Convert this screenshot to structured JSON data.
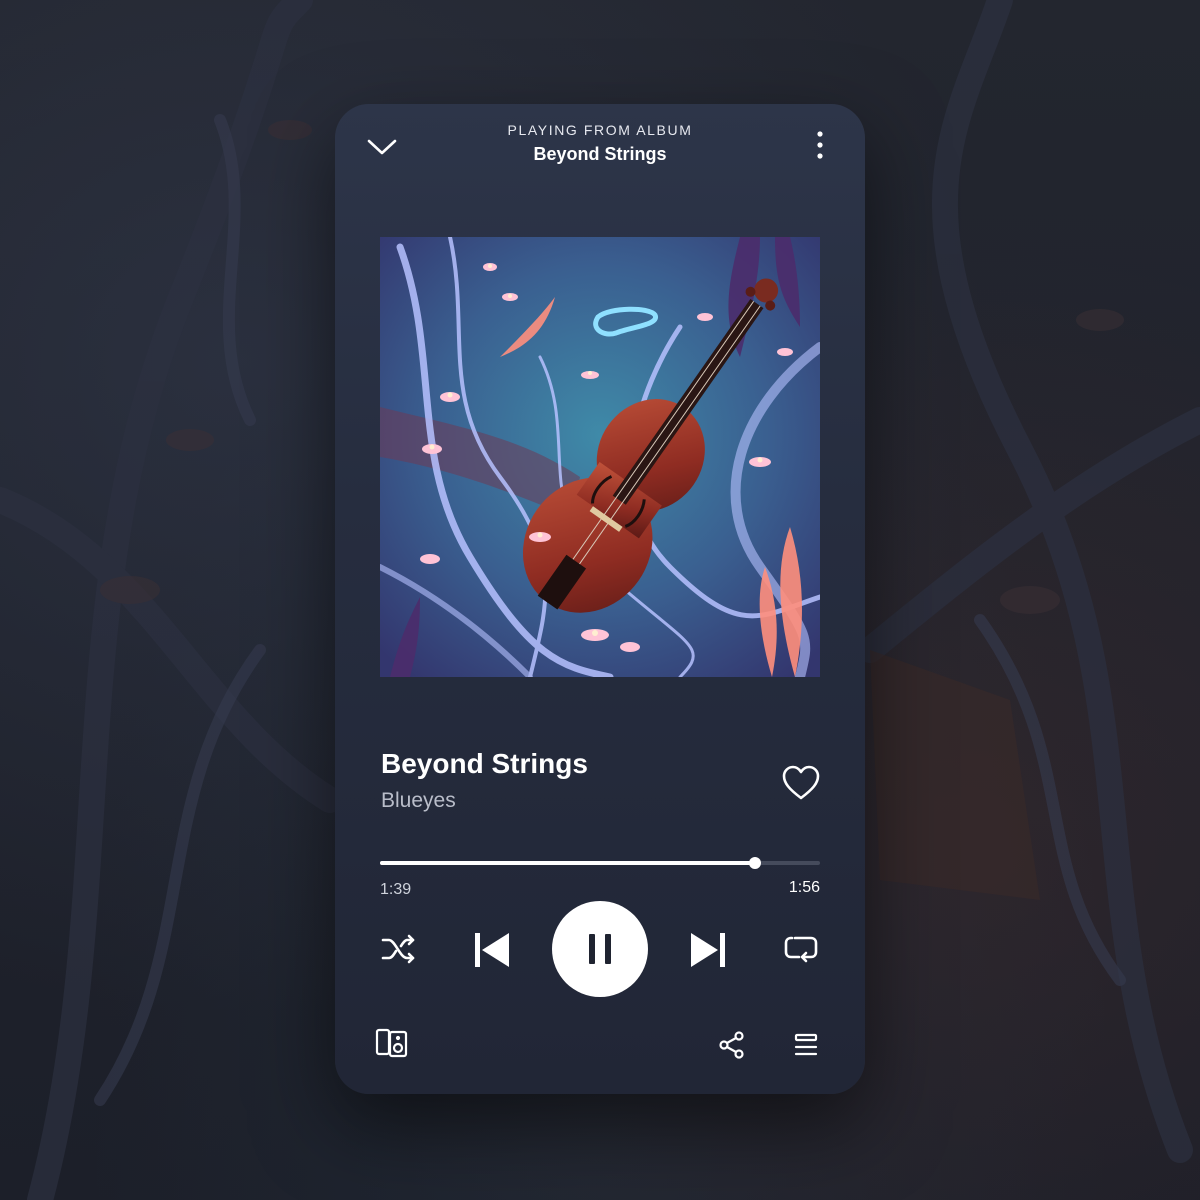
{
  "header": {
    "context_label": "PLAYING FROM ALBUM",
    "context_name": "Beyond Strings",
    "collapse_icon": "chevron-down-icon",
    "more_icon": "more-vertical-icon"
  },
  "album_art": {
    "description_icon": "album-cover-violin-illustration"
  },
  "track": {
    "title": "Beyond Strings",
    "artist": "Blueyes",
    "liked": false
  },
  "playback": {
    "elapsed": "1:39",
    "duration": "1:56",
    "progress_fraction": 0.853,
    "state": "playing"
  },
  "controls": {
    "shuffle_icon": "shuffle-icon",
    "previous_icon": "skip-previous-icon",
    "play_pause_icon": "pause-icon",
    "next_icon": "skip-next-icon",
    "repeat_icon": "repeat-icon"
  },
  "footer": {
    "devices_icon": "connect-devices-icon",
    "share_icon": "share-icon",
    "queue_icon": "queue-icon"
  },
  "colors": {
    "panel_top": "#2d3549",
    "panel_bottom": "#212636",
    "accent": "#ffffff",
    "muted_text": "#b9bdc9"
  }
}
